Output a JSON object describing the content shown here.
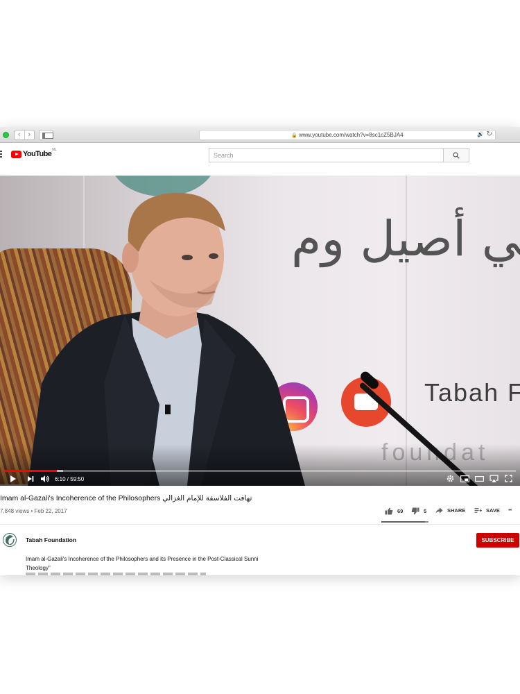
{
  "browser": {
    "url": "www.youtube.com/watch?v=8sc1cZ5BJA4",
    "back_glyph": "‹",
    "forward_glyph": "›"
  },
  "header": {
    "logo_text": "YouTube",
    "logo_region": "NL",
    "search_placeholder": "Search"
  },
  "player": {
    "time_label": "6:10 / 59:50",
    "played_fraction": 0.103,
    "buffered_fraction": 0.115,
    "wall_text_arabic": "سلامي أصيل وم",
    "wall_text_tabah": "Tabah F",
    "wall_text_foundation": "foundat"
  },
  "video": {
    "title": "Imam al-Gazali's Incoherence of the Philosophers تهافت الفلاسفة للإمام الغزالي",
    "views_date": "7,848 views • Feb 22, 2017",
    "like_count": "69",
    "dislike_count": "5",
    "share_label": "SHARE",
    "save_label": "SAVE",
    "more_label": "•••",
    "like_ratio": 0.93
  },
  "channel": {
    "name": "Tabah Foundation",
    "subscribe_label": "SUBSCRIBE"
  },
  "description": {
    "text": "Imam al-Gazali's Incoherence of the Philosophers and its Presence in the Post-Classical Sunni Theology\""
  },
  "colors": {
    "accent_red": "#ff0000",
    "subscribe_red": "#cc0000"
  }
}
